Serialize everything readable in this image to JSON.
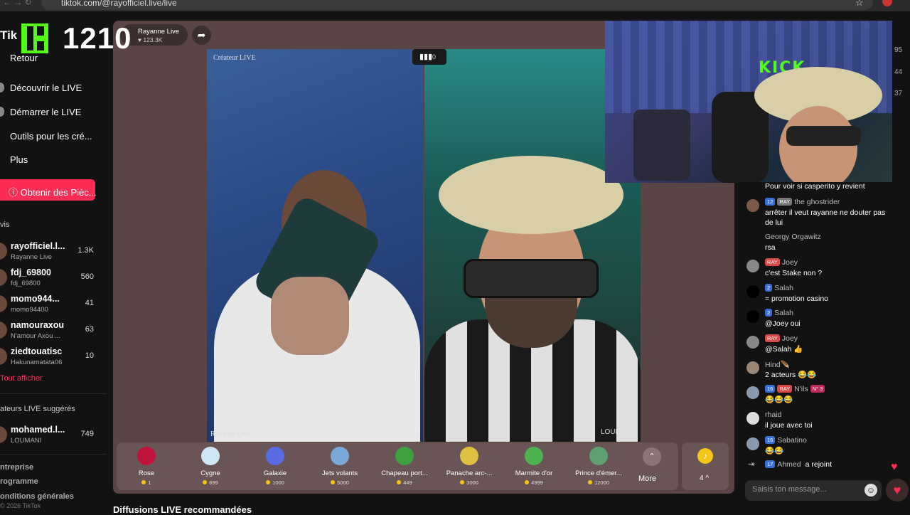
{
  "browser": {
    "url": "tiktok.com/@rayofficiel.live/live"
  },
  "sidebar": {
    "logo": "Tik",
    "back": "Retour",
    "nav": [
      "Découvrir le LIVE",
      "Démarrer le LIVE",
      "Outils pour les cré...",
      "Plus"
    ],
    "coins_button": "Obtenir des Pièc...",
    "following_title": "vis",
    "accounts": [
      {
        "name": "rayofficiel.l...",
        "sub": "Rayanne Live",
        "count": "1.3K"
      },
      {
        "name": "fdj_69800",
        "sub": "fdj_69800",
        "count": "560"
      },
      {
        "name": "momo944...",
        "sub": "momo94400",
        "count": "41"
      },
      {
        "name": "namouraxou",
        "sub": "N'amour Axou ...",
        "count": "63"
      },
      {
        "name": "ziedtouatisc",
        "sub": "Hakunamatata06",
        "count": "10"
      }
    ],
    "see_all": "Tout afficher",
    "suggested_title": "ateurs LIVE suggérés",
    "suggested": {
      "name": "mohamed.l...",
      "sub": "LOUMANI",
      "count": "749"
    },
    "footer": [
      "ntreprise",
      "rogramme",
      "onditions générales"
    ],
    "copyright": "© 2026 TikTok"
  },
  "overlay": {
    "viewer_count": "1210"
  },
  "host": {
    "name": "Rayanne Live",
    "likes": "123.3K"
  },
  "stream": {
    "left_top_label": "Créateur LIVE",
    "left_bottom_label": "Rayanne Live",
    "right_bottom_label": "LOUMANI",
    "mid_count": "0"
  },
  "cam_overlay": {
    "sign": "KICK"
  },
  "right_numbers": [
    "95",
    "44",
    "37"
  ],
  "gifts": [
    {
      "name": "Rose",
      "price": "1",
      "color": "#c0143c"
    },
    {
      "name": "Cygne",
      "price": "699",
      "color": "#cfe6f5"
    },
    {
      "name": "Galaxie",
      "price": "1000",
      "color": "#5a6ae0"
    },
    {
      "name": "Jets volants",
      "price": "5000",
      "color": "#7aa8d8"
    },
    {
      "name": "Chapeau port...",
      "price": "449",
      "color": "#3fa040"
    },
    {
      "name": "Panache arc-...",
      "price": "3000",
      "color": "#e0c040"
    },
    {
      "name": "Marmite d'or",
      "price": "4999",
      "color": "#4fb04f"
    },
    {
      "name": "Prince d'émer...",
      "price": "12000",
      "color": "#60a070"
    }
  ],
  "more_label": "More",
  "coin_label": "4 ^",
  "recommended_title": "Diffusions LIVE recommandées",
  "chat": {
    "messages": [
      {
        "badges": [],
        "user": "",
        "text": "Pour voir si casperito y revient"
      },
      {
        "badges": [
          [
            "12",
            "b-blue"
          ],
          [
            "RAY",
            "b-gray"
          ]
        ],
        "user": "the ghostrider",
        "text": "arrêter il veut rayanne ne douter pas de lui"
      },
      {
        "badges": [],
        "user": "Georgy Orgawitz",
        "text": "rsa"
      },
      {
        "badges": [
          [
            "RAY",
            "b-red"
          ]
        ],
        "user": "Joey",
        "text": "c'est Stake non ?"
      },
      {
        "badges": [
          [
            "2",
            "b-blue"
          ]
        ],
        "user": "Salah",
        "text": "= promotion casino"
      },
      {
        "badges": [
          [
            "2",
            "b-blue"
          ]
        ],
        "user": "Salah",
        "text": "@Joey oui"
      },
      {
        "badges": [
          [
            "RAY",
            "b-red"
          ]
        ],
        "user": "Joey",
        "text": "@Salah 👍"
      },
      {
        "badges": [],
        "user": "Hind🪶",
        "text": "2 acteurs 😂😂"
      },
      {
        "badges": [
          [
            "16",
            "b-blue"
          ],
          [
            "RAY",
            "b-red"
          ]
        ],
        "user": "N'ils",
        "extra": "N° 3",
        "text": "😂😂😂"
      },
      {
        "badges": [],
        "user": "rhaid",
        "text": "il joue avec toi"
      },
      {
        "badges": [
          [
            "16",
            "b-blue"
          ]
        ],
        "user": "Sabatino",
        "text": "😂😂"
      }
    ],
    "join": {
      "badge": "17",
      "user": "Ahmed",
      "action": "a rejoint"
    },
    "input_placeholder": "Saisis ton message..."
  }
}
